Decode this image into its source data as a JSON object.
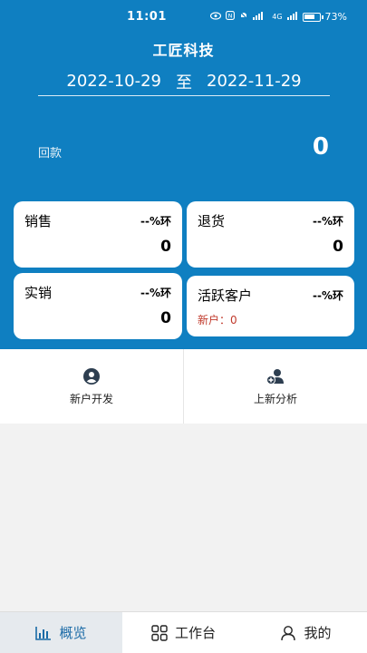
{
  "status_bar": {
    "time": "11:01",
    "network": "4G",
    "battery": "73%"
  },
  "header": {
    "title": "工匠科技"
  },
  "date_range": {
    "start": "2022-10-29",
    "separator": "至",
    "end": "2022-11-29"
  },
  "payment": {
    "label": "回款",
    "value": "0"
  },
  "cards": {
    "sales": {
      "title": "销售",
      "ratio": "--%环",
      "value": "0"
    },
    "returns": {
      "title": "退货",
      "ratio": "--%环",
      "value": "0"
    },
    "actual_sales": {
      "title": "实销",
      "ratio": "--%环",
      "value": "0"
    },
    "active_customers": {
      "title": "活跃客户",
      "ratio": "--%环",
      "new_label": "新户：0"
    }
  },
  "actions": {
    "new_customer_dev": {
      "label": "新户开发",
      "icon": "user-circle-icon"
    },
    "new_product_analysis": {
      "label": "上新分析",
      "icon": "user-add-icon"
    }
  },
  "tabs": [
    {
      "label": "概览",
      "icon": "bar-chart-icon",
      "active": true
    },
    {
      "label": "工作台",
      "icon": "grid-icon",
      "active": false
    },
    {
      "label": "我的",
      "icon": "user-icon",
      "active": false
    }
  ],
  "colors": {
    "primary": "#0f7fc1",
    "negative": "#c0392b"
  }
}
